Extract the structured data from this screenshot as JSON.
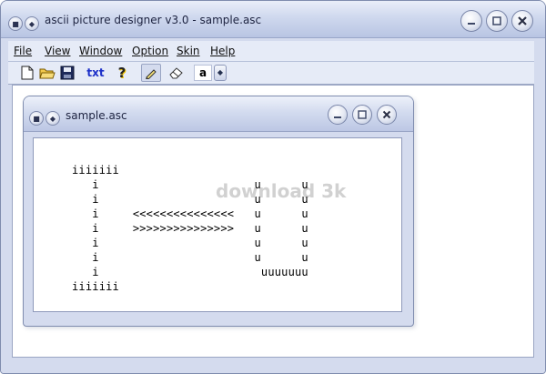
{
  "app": {
    "title": "ascii picture designer v3.0 - sample.asc"
  },
  "menu": [
    "File",
    "View",
    "Window",
    "Option",
    "Skin",
    "Help"
  ],
  "toolbar": {
    "txt_label": "txt",
    "char_value": "a"
  },
  "document": {
    "title": "sample.asc",
    "content": "iiiiiii\n   i                       u      u\n   i                       u      u\n   i     <<<<<<<<<<<<<<<   u      u\n   i     >>>>>>>>>>>>>>>   u      u\n   i                       u      u\n   i                       u      u\n   i                        uuuuuuu\niiiiiii"
  },
  "watermark": "download 3k"
}
